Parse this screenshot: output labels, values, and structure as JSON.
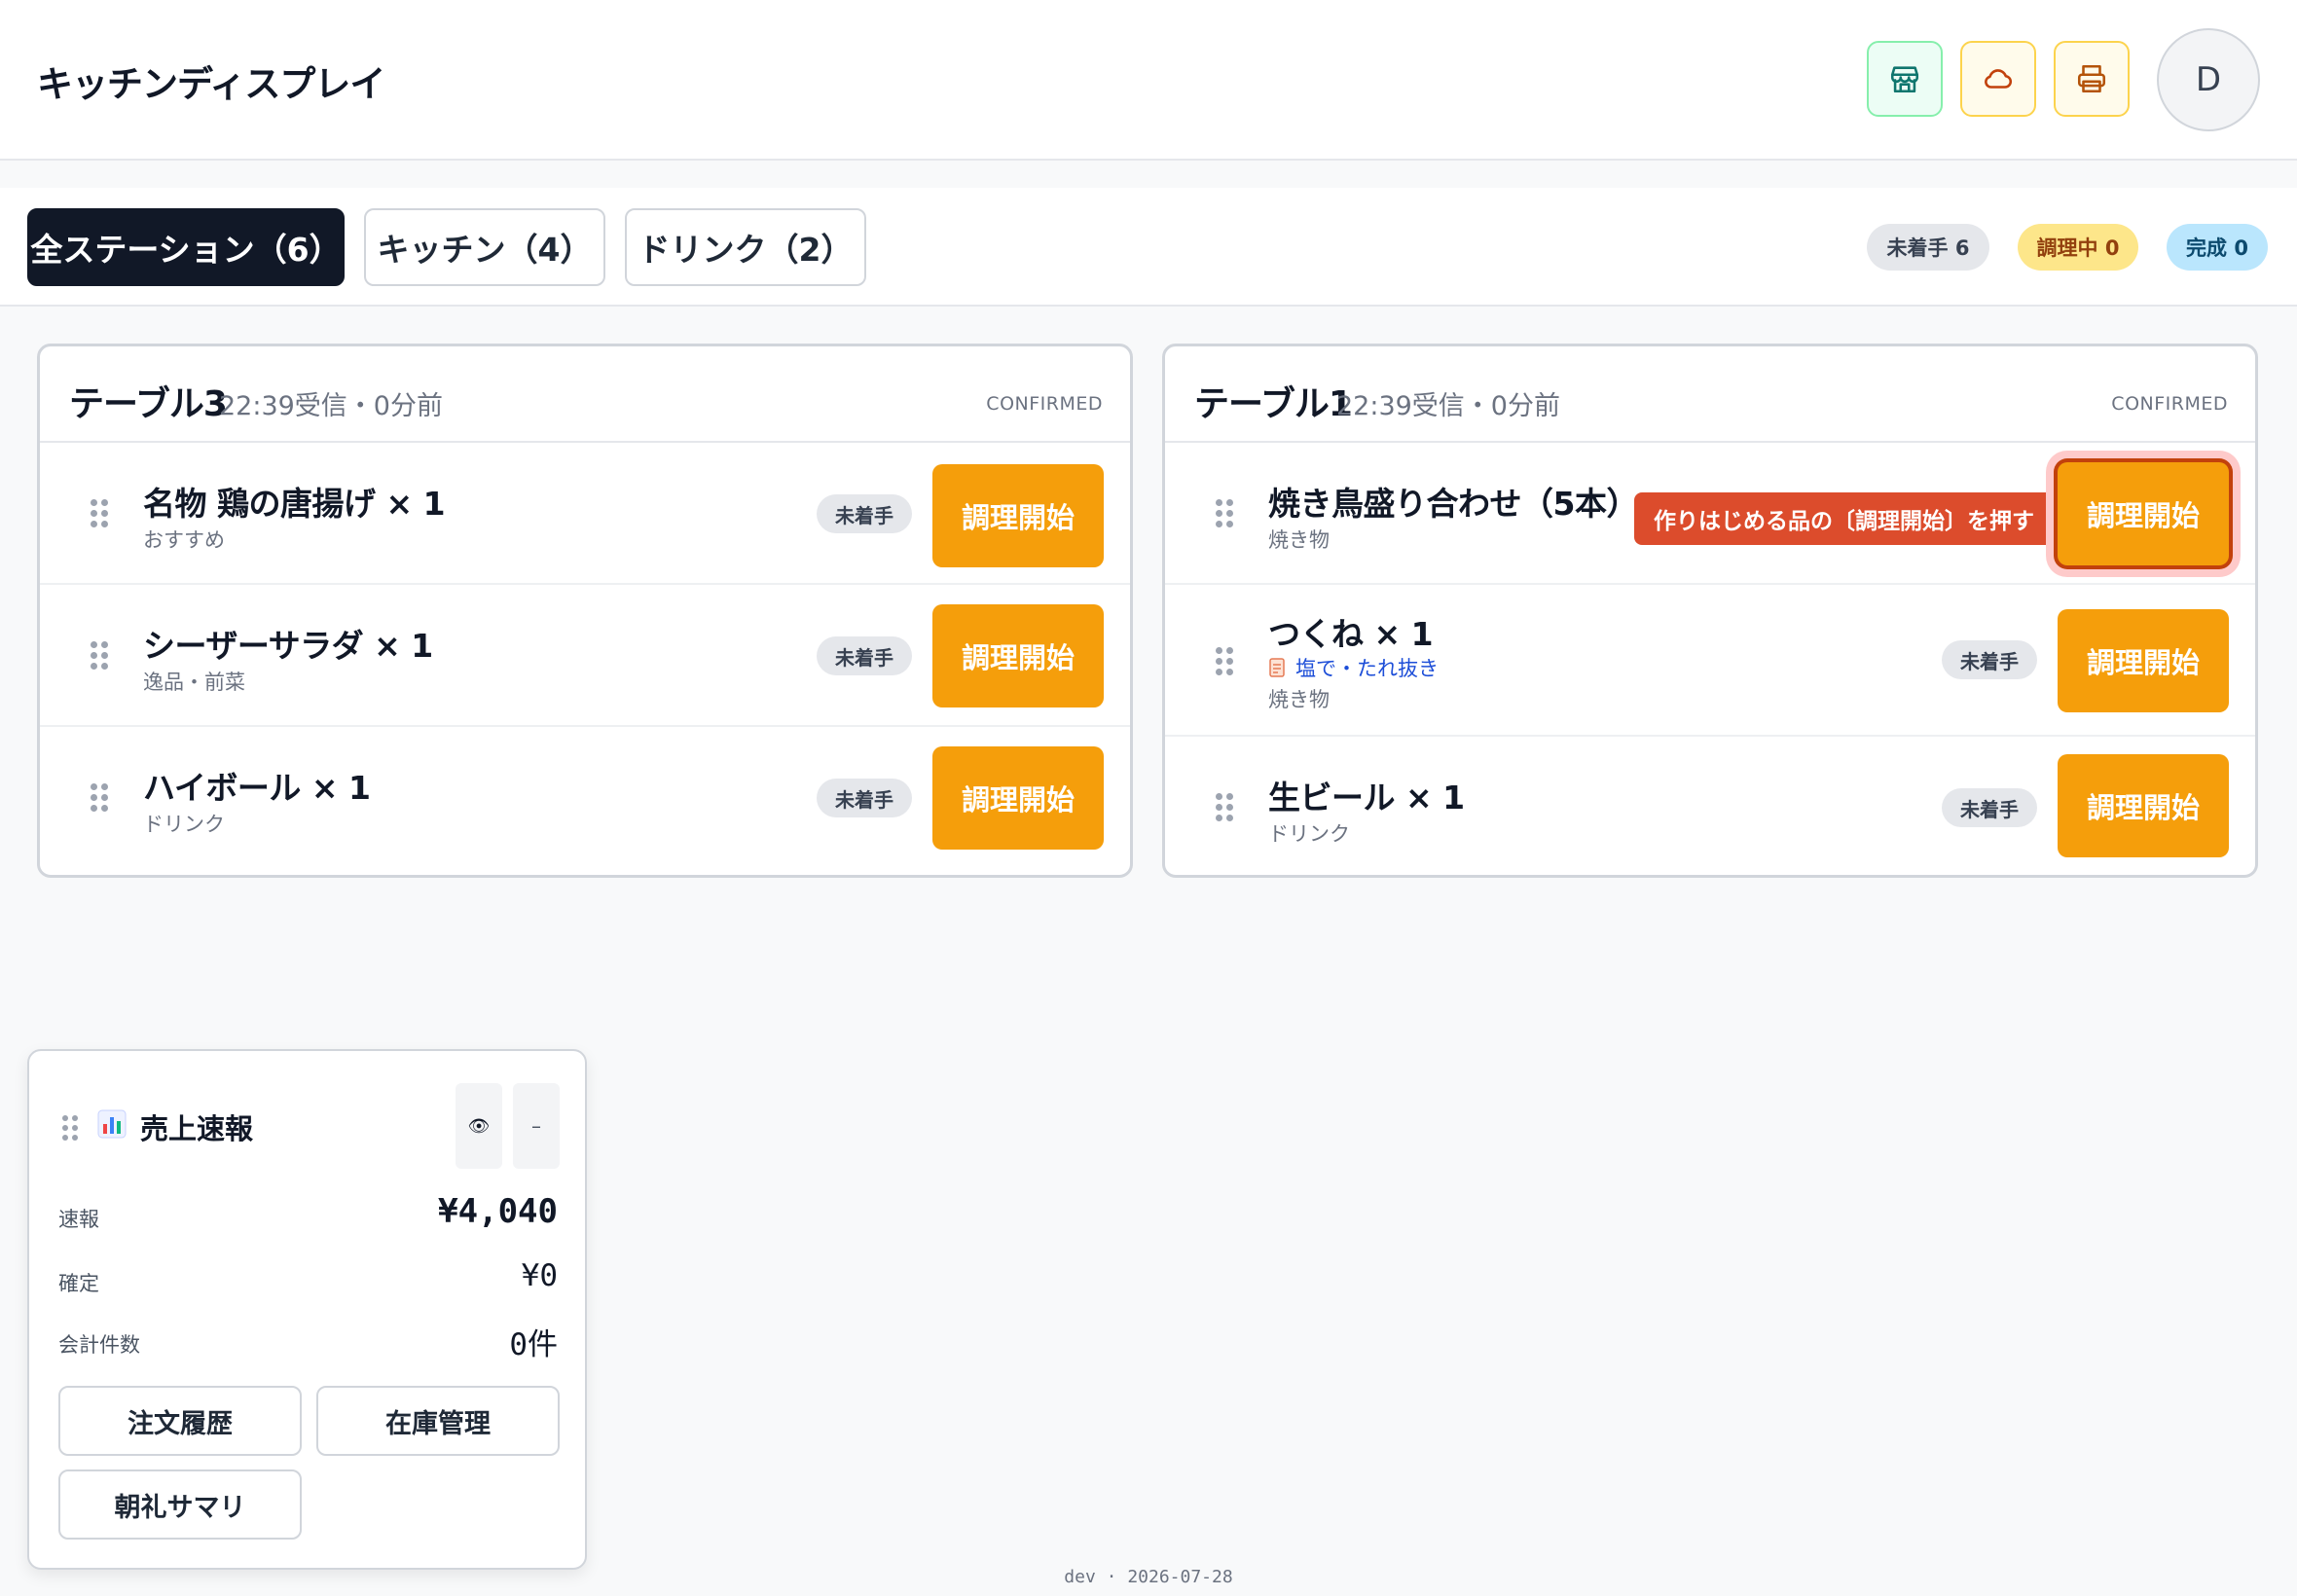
{
  "header": {
    "title": "キッチンディスプレイ",
    "avatar_initial": "D",
    "icons": [
      "store-icon",
      "cloud-icon",
      "printer-icon"
    ]
  },
  "tabs": [
    {
      "label": "全ステーション（6）",
      "active": true
    },
    {
      "label": "キッチン（4）",
      "active": false
    },
    {
      "label": "ドリンク（2）",
      "active": false
    }
  ],
  "status_pills": {
    "pending": "未着手 6",
    "cooking": "調理中 0",
    "done": "完成 0"
  },
  "orders": [
    {
      "table": "テーブル3",
      "meta": "22:39受信・0分前",
      "status": "CONFIRMED",
      "items": [
        {
          "name": "名物 鶏の唐揚げ × 1",
          "category": "おすすめ",
          "badge": "未着手",
          "action": "調理開始"
        },
        {
          "name": "シーザーサラダ × 1",
          "category": "逸品・前菜",
          "badge": "未着手",
          "action": "調理開始"
        },
        {
          "name": "ハイボール × 1",
          "category": "ドリンク",
          "badge": "未着手",
          "action": "調理開始"
        }
      ]
    },
    {
      "table": "テーブル1",
      "meta": "22:39受信・0分前",
      "status": "CONFIRMED",
      "items": [
        {
          "name": "焼き鳥盛り合わせ（5本）",
          "category": "焼き物",
          "callout": "作りはじめる品の〔調理開始〕を押す",
          "action": "調理開始"
        },
        {
          "name": "つくね × 1",
          "note": "塩で・たれ抜き",
          "category": "焼き物",
          "badge": "未着手",
          "action": "調理開始"
        },
        {
          "name": "生ビール × 1",
          "category": "ドリンク",
          "badge": "未着手",
          "action": "調理開始"
        }
      ]
    }
  ],
  "sales_widget": {
    "title": "売上速報",
    "eye_icon": "👁",
    "minimize": "–",
    "rows": [
      {
        "label": "速報",
        "value": "¥4,040"
      },
      {
        "label": "確定",
        "value": "¥0"
      },
      {
        "label": "会計件数",
        "value": "0件"
      }
    ],
    "buttons": [
      "注文履歴",
      "在庫管理",
      "朝礼サマリ"
    ]
  },
  "footer": "dev · 2026-07-28",
  "colors": {
    "accent_orange": "#f59e0b",
    "callout_red": "#dc4c2c",
    "dark": "#111827"
  }
}
